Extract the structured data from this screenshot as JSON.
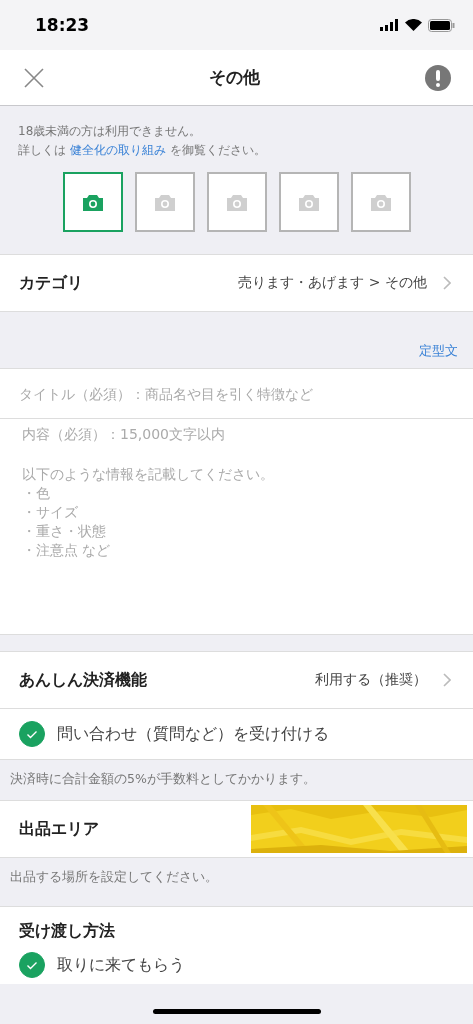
{
  "status_bar": {
    "time": "18:23"
  },
  "nav": {
    "title": "その他"
  },
  "notice": {
    "line1": "18歳未満の方は利用できません。",
    "line2_before": "詳しくは ",
    "link": "健全化の取り組み",
    "line2_after": " を御覧ください。"
  },
  "photos": [
    {
      "selected": true
    },
    {
      "selected": false
    },
    {
      "selected": false
    },
    {
      "selected": false
    },
    {
      "selected": false
    }
  ],
  "category": {
    "label": "カテゴリ",
    "value": "売ります・あげます > その他"
  },
  "template_link": "定型文",
  "title_field": {
    "placeholder": "タイトル（必須）：商品名や目を引く特徴など"
  },
  "content_field": {
    "placeholder": "内容（必須）：15,000文字以内",
    "hint_lines": [
      "以下のような情報を記載してください。",
      "・色",
      "・サイズ",
      "・重さ・状態",
      "・注意点 など"
    ]
  },
  "payment": {
    "label": "あんしん決済機能",
    "value": "利用する（推奨）"
  },
  "inquiry": {
    "label": "問い合わせ（質問など）を受け付ける",
    "checked": true
  },
  "payment_note": "決済時に合計金額の5%が手数料としてかかります。",
  "area": {
    "label": "出品エリア"
  },
  "area_note": "出品する場所を設定してください。",
  "handover": {
    "label": "受け渡し方法",
    "options": [
      {
        "label": "取りに来てもらう",
        "checked": true
      }
    ]
  }
}
